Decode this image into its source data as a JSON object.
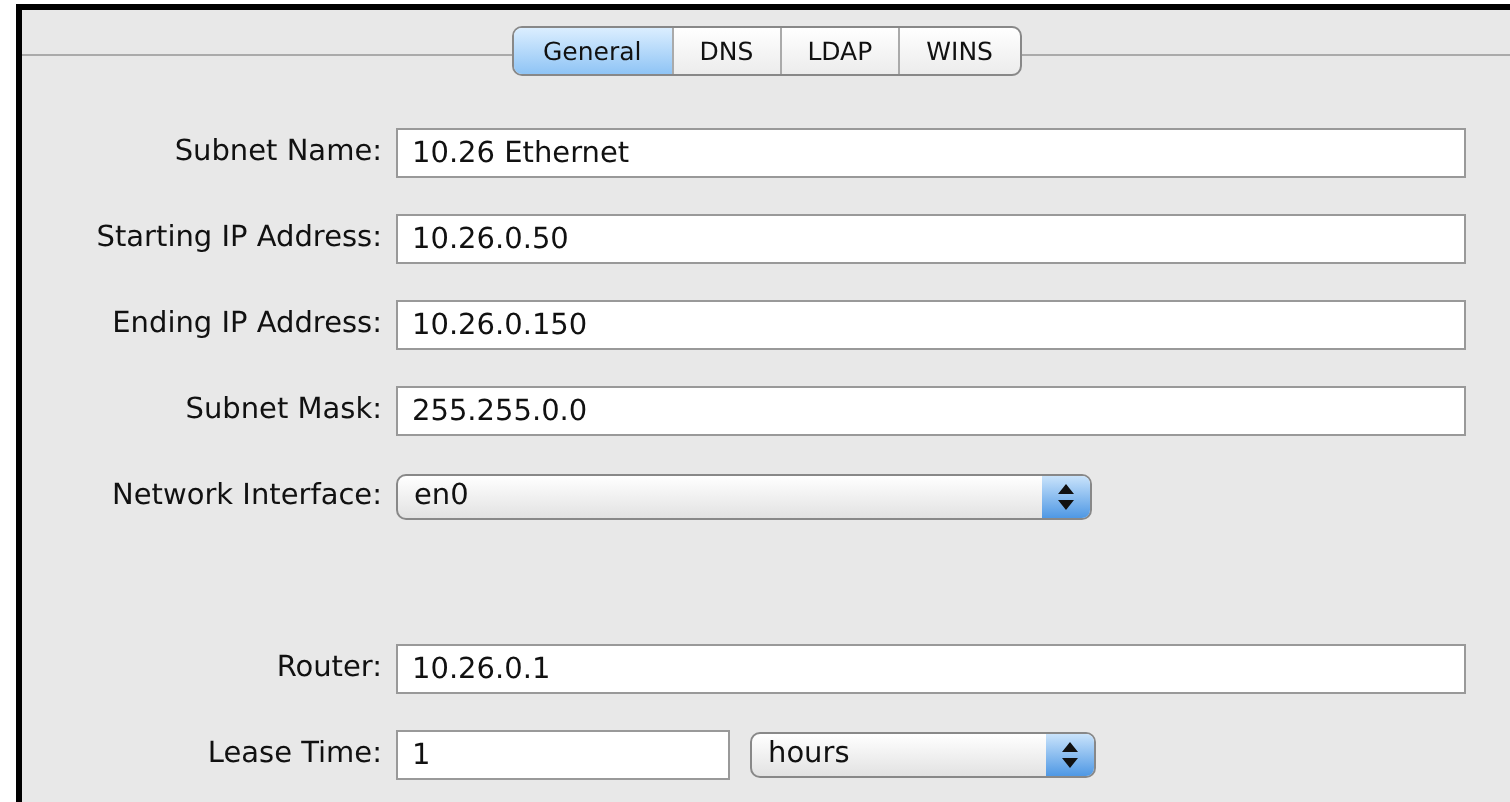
{
  "tabs": [
    {
      "label": "General",
      "selected": true
    },
    {
      "label": "DNS",
      "selected": false
    },
    {
      "label": "LDAP",
      "selected": false
    },
    {
      "label": "WINS",
      "selected": false
    }
  ],
  "rows": [
    {
      "kind": "text",
      "label": "Subnet Name:",
      "value": "10.26 Ethernet"
    },
    {
      "kind": "text",
      "label": "Starting IP Address:",
      "value": "10.26.0.50"
    },
    {
      "kind": "text",
      "label": "Ending IP Address:",
      "value": "10.26.0.150"
    },
    {
      "kind": "text",
      "label": "Subnet Mask:",
      "value": "255.255.0.0"
    },
    {
      "kind": "popup",
      "label": "Network Interface:",
      "value": "en0"
    },
    {
      "kind": "spacer"
    },
    {
      "kind": "text",
      "label": "Router:",
      "value": "10.26.0.1"
    },
    {
      "kind": "lease",
      "label": "Lease Time:",
      "value": "1",
      "unit": "hours"
    }
  ]
}
